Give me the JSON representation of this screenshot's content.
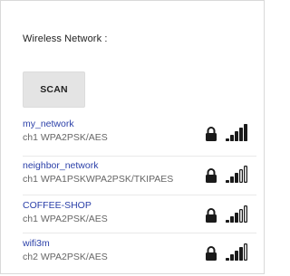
{
  "screen": {
    "title": "Wireless Network :",
    "scan_label": "SCAN"
  },
  "networks": [
    {
      "name": "my_network",
      "detail": "ch1 WPA2PSK/AES",
      "secured": true,
      "signal_bars": 4
    },
    {
      "name": "neighbor_network",
      "detail": "ch1 WPA1PSKWPA2PSK/TKIPAES",
      "secured": true,
      "signal_bars": 2
    },
    {
      "name": "COFFEE-SHOP",
      "detail": "ch1 WPA2PSK/AES",
      "secured": true,
      "signal_bars": 2
    },
    {
      "name": "wifi3m",
      "detail": "ch2 WPA2PSK/AES",
      "secured": true,
      "signal_bars": 3
    }
  ],
  "colors": {
    "network_name": "#2a3fa8",
    "detail_text": "#666666",
    "icon": "#1a1a1a"
  },
  "icons": {
    "lock": "lock-icon",
    "signal": "wifi-signal-icon"
  }
}
